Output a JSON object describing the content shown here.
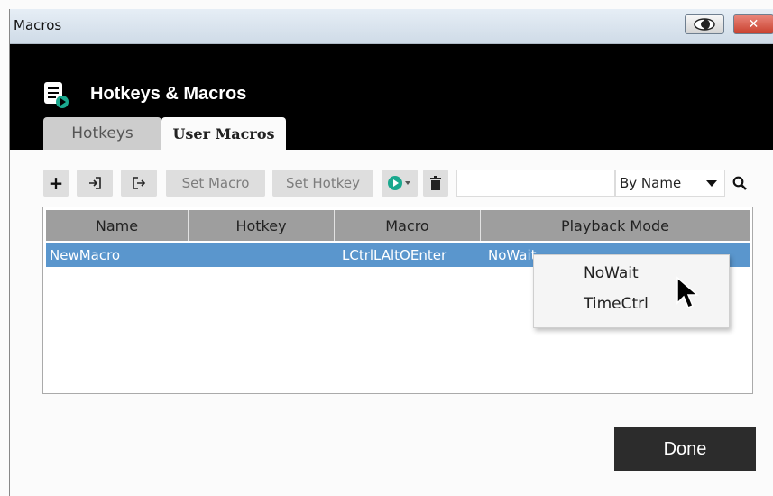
{
  "window": {
    "title": "Macros"
  },
  "header": {
    "title": "Hotkeys & Macros"
  },
  "tabs": [
    {
      "label": "Hotkeys",
      "active": false
    },
    {
      "label": "User Macros",
      "active": true
    }
  ],
  "toolbar": {
    "set_macro_label": "Set Macro",
    "set_hotkey_label": "Set Hotkey",
    "search_placeholder": "",
    "sort_value": "By Name"
  },
  "table": {
    "columns": [
      "Name",
      "Hotkey",
      "Macro",
      "Playback Mode"
    ],
    "rows": [
      {
        "name": "NewMacro",
        "hotkey": "",
        "macro": "LCtrlLAltOEnter",
        "playback_mode": "NoWait"
      }
    ]
  },
  "playback_dropdown": {
    "options": [
      "NoWait",
      "TimeCtrl"
    ]
  },
  "footer": {
    "done_label": "Done"
  },
  "colors": {
    "header_bg": "#000000",
    "selected_row": "#5a96cd",
    "play_icon": "#1aa88e",
    "done_button": "#2c2c2c"
  }
}
